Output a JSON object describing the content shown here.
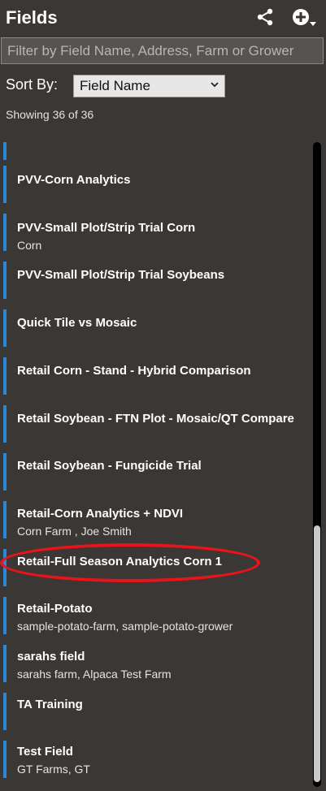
{
  "header": {
    "title": "Fields",
    "share_icon": "share-icon",
    "add_icon": "add-circle-icon"
  },
  "filter": {
    "placeholder": "Filter by Field Name, Address, Farm or Grower",
    "value": ""
  },
  "sort": {
    "label": "Sort By:",
    "selected": "Field Name"
  },
  "showing": "Showing 36 of 36",
  "list": {
    "items": [
      {
        "name": "",
        "sub": ""
      },
      {
        "name": "PVV-Corn Analytics",
        "sub": ""
      },
      {
        "name": "PVV-Small Plot/Strip Trial Corn",
        "sub": "Corn"
      },
      {
        "name": "PVV-Small Plot/Strip Trial Soybeans",
        "sub": ""
      },
      {
        "name": "Quick Tile vs Mosaic",
        "sub": ""
      },
      {
        "name": "Retail Corn - Stand - Hybrid Comparison",
        "sub": ""
      },
      {
        "name": "Retail Soybean  - FTN Plot - Mosaic/QT Compare",
        "sub": ""
      },
      {
        "name": "Retail Soybean - Fungicide Trial",
        "sub": ""
      },
      {
        "name": "Retail-Corn Analytics + NDVI",
        "sub": "Corn Farm , Joe Smith"
      },
      {
        "name": "Retail-Full Season Analytics Corn 1",
        "sub": ""
      },
      {
        "name": "Retail-Potato",
        "sub": "sample-potato-farm, sample-potato-grower"
      },
      {
        "name": "sarahs field",
        "sub": "sarahs farm, Alpaca Test Farm"
      },
      {
        "name": "TA Training",
        "sub": ""
      },
      {
        "name": "Test Field",
        "sub": "GT Farms, GT"
      }
    ]
  },
  "colors": {
    "accent_bar": "#2b87d8",
    "highlight": "#e8141a",
    "background": "#3b3735"
  }
}
